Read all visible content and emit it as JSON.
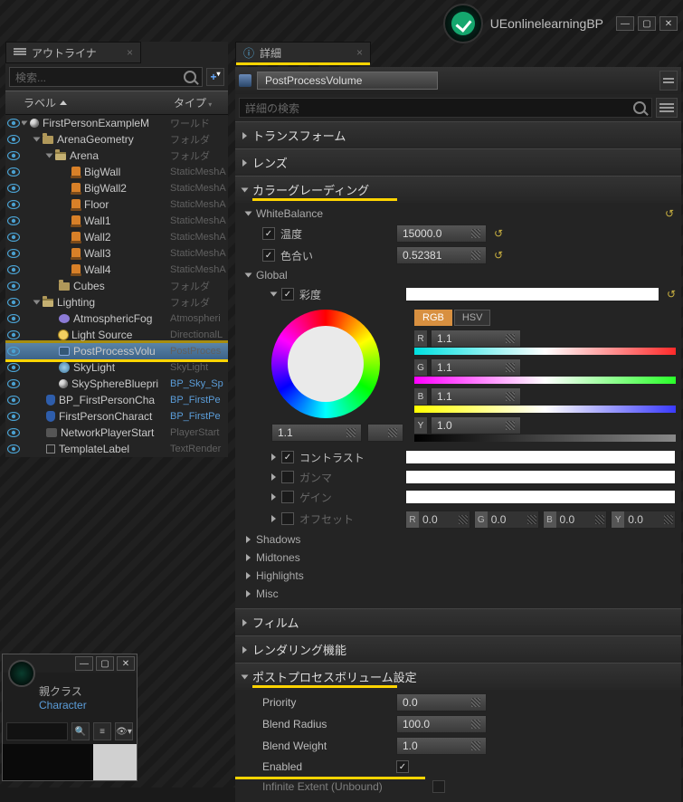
{
  "project_name": "UEonlinelearningBP",
  "outliner": {
    "tab_title": "アウトライナ",
    "search_placeholder": "検索...",
    "col_label": "ラベル",
    "col_type": "タイプ",
    "rows": [
      {
        "indent": 0,
        "open": true,
        "icon": "world",
        "label": "FirstPersonExampleM",
        "type": "ワールド"
      },
      {
        "indent": 1,
        "open": true,
        "icon": "folder",
        "label": "ArenaGeometry",
        "type": "フォルダ"
      },
      {
        "indent": 2,
        "open": true,
        "icon": "folder-open",
        "label": "Arena",
        "type": "フォルダ"
      },
      {
        "indent": 3,
        "icon": "mesh",
        "label": "BigWall",
        "type": "StaticMeshA"
      },
      {
        "indent": 3,
        "icon": "mesh",
        "label": "BigWall2",
        "type": "StaticMeshA"
      },
      {
        "indent": 3,
        "icon": "mesh",
        "label": "Floor",
        "type": "StaticMeshA"
      },
      {
        "indent": 3,
        "icon": "mesh",
        "label": "Wall1",
        "type": "StaticMeshA"
      },
      {
        "indent": 3,
        "icon": "mesh",
        "label": "Wall2",
        "type": "StaticMeshA"
      },
      {
        "indent": 3,
        "icon": "mesh",
        "label": "Wall3",
        "type": "StaticMeshA"
      },
      {
        "indent": 3,
        "icon": "mesh",
        "label": "Wall4",
        "type": "StaticMeshA"
      },
      {
        "indent": 2,
        "icon": "folder",
        "label": "Cubes",
        "type": "フォルダ"
      },
      {
        "indent": 1,
        "open": true,
        "icon": "folder-open",
        "label": "Lighting",
        "type": "フォルダ"
      },
      {
        "indent": 2,
        "icon": "fog",
        "label": "AtmosphericFog",
        "type": "Atmospheri"
      },
      {
        "indent": 2,
        "icon": "sun",
        "label": "Light Source",
        "type": "DirectionalL"
      },
      {
        "indent": 2,
        "icon": "ppv",
        "label": "PostProcessVolu",
        "type": "PostProces",
        "selected": true
      },
      {
        "indent": 2,
        "icon": "sky",
        "label": "SkyLight",
        "type": "SkyLight"
      },
      {
        "indent": 2,
        "icon": "sphere",
        "label": "SkySphereBluepri",
        "type": "BP_Sky_Sp",
        "link": true
      },
      {
        "indent": 1,
        "icon": "bp",
        "label": "BP_FirstPersonCha",
        "type": "BP_FirstPe",
        "link": true
      },
      {
        "indent": 1,
        "icon": "bp",
        "label": "FirstPersonCharact",
        "type": "BP_FirstPe",
        "link": true
      },
      {
        "indent": 1,
        "icon": "net",
        "label": "NetworkPlayerStart",
        "type": "PlayerStart"
      },
      {
        "indent": 1,
        "icon": "label",
        "label": "TemplateLabel",
        "type": "TextRender"
      }
    ]
  },
  "mini": {
    "parent_label": "親クラス",
    "parent_link": "Character"
  },
  "details": {
    "tab_title": "詳細",
    "actor_name": "PostProcessVolume",
    "search_placeholder": "詳細の検索",
    "cat_transform": "トランスフォーム",
    "cat_lens": "レンズ",
    "cat_color_grading": "カラーグレーディング",
    "wb_head": "WhiteBalance",
    "wb_temp_label": "温度",
    "wb_temp_val": "15000.0",
    "wb_tint_label": "色合い",
    "wb_tint_val": "0.52381",
    "global_head": "Global",
    "saturation_label": "彩度",
    "rgb_tab": "RGB",
    "hsv_tab": "HSV",
    "r_label": "R",
    "g_label": "G",
    "b_label": "B",
    "y_label": "Y",
    "r_val": "1.1",
    "g_val": "1.1",
    "b_val": "1.1",
    "y_val": "1.0",
    "wheel_val": "1.1",
    "contrast_label": "コントラスト",
    "gamma_label": "ガンマ",
    "gain_label": "ゲイン",
    "offset_label": "オフセット",
    "off_r": "0.0",
    "off_g": "0.0",
    "off_b": "0.0",
    "off_y": "0.0",
    "shadows": "Shadows",
    "midtones": "Midtones",
    "highlights": "Highlights",
    "misc": "Misc",
    "cat_film": "フィルム",
    "cat_render": "レンダリング機能",
    "cat_ppv_settings": "ポストプロセスボリューム設定",
    "priority_label": "Priority",
    "priority_val": "0.0",
    "blend_radius_label": "Blend Radius",
    "blend_radius_val": "100.0",
    "blend_weight_label": "Blend Weight",
    "blend_weight_val": "1.0",
    "enabled_label": "Enabled",
    "infinite_label": "Infinite Extent (Unbound)"
  }
}
